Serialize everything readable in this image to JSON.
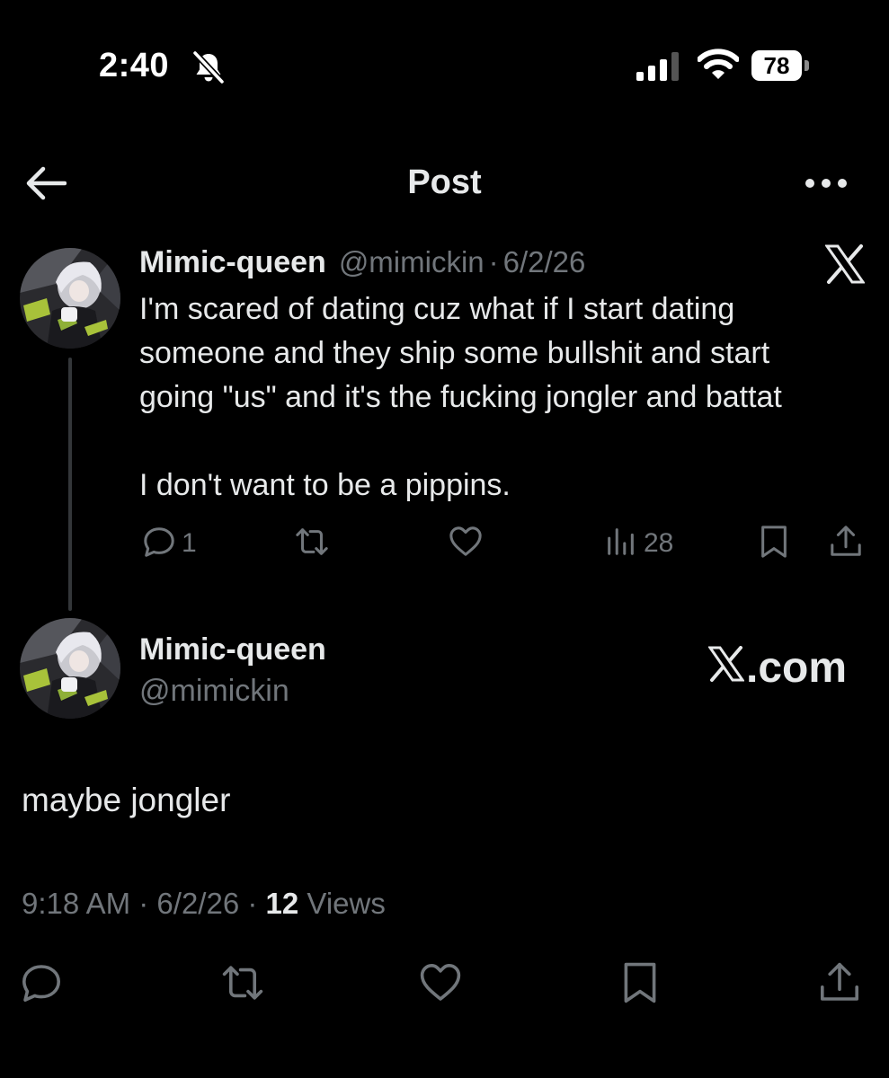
{
  "status_bar": {
    "time": "2:40",
    "battery": "78",
    "icons": [
      "bell-slash-icon",
      "signal-icon",
      "wifi-icon",
      "battery-icon"
    ]
  },
  "header": {
    "title": "Post",
    "icons": [
      "back-arrow-icon",
      "more-icon"
    ]
  },
  "quoted_post": {
    "display_name": "Mimic-queen",
    "handle": "@mimickin",
    "separator": "·",
    "date": "6/2/26",
    "text": "I'm scared of dating cuz what if I start dating\nsomeone and they ship some bullshit and start\ngoing \"us\" and it's the fucking jongler and battat\n\nI don't want to be a pippins.",
    "replies": "1",
    "views": "28",
    "icons": [
      "reply-icon",
      "repost-icon",
      "like-icon",
      "views-icon",
      "bookmark-icon",
      "share-icon",
      "x-logo-icon"
    ]
  },
  "main_post": {
    "display_name": "Mimic-queen",
    "handle": "@mimickin",
    "brand": ".com",
    "text": "maybe jongler",
    "time": "9:18 AM",
    "separator": "·",
    "date": "6/2/26",
    "views_count": "12",
    "views_label": "Views",
    "icons": [
      "reply-icon",
      "repost-icon",
      "like-icon",
      "bookmark-icon",
      "share-icon"
    ]
  },
  "colors": {
    "background": "#000000",
    "text": "#e7e9ea",
    "muted": "#71767b",
    "thread_line": "#333639"
  }
}
